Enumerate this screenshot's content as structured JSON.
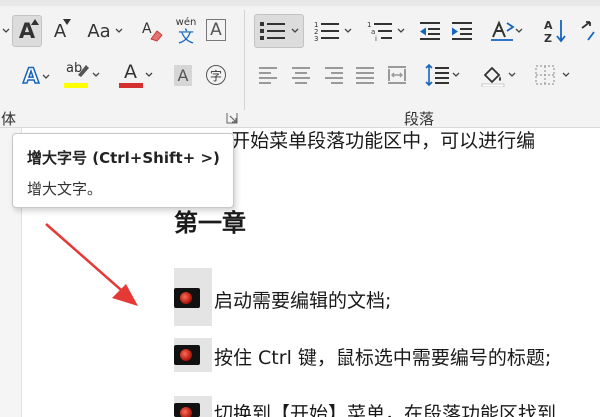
{
  "ribbon": {
    "font_size_dropdown_partial": "",
    "grow_font_label": "A",
    "shrink_font_label": "A",
    "change_case_label": "Aa",
    "phonetic_top": "wén",
    "phonetic_bottom": "文",
    "char_border_label": "A",
    "text_effects_label": "A",
    "highlight_label": "ab",
    "font_color_label": "A",
    "char_shading_label": "A",
    "enclose_char_label": "字",
    "font_group_label": "字体",
    "paragraph_group_label": "段落",
    "sort_label": "A↓Z",
    "highlight_color": "#ffff00",
    "font_color": "#d32f2f"
  },
  "tooltip": {
    "title": "增大字号 (Ctrl+Shift+ >)",
    "description": "增大文字。"
  },
  "document": {
    "partial_top_line": "d 开始菜单段落功能区中，可以进行编",
    "heading": "第一章",
    "lines": [
      "启动需要编辑的文档;",
      "按住 Ctrl 键，鼠标选中需要编号的标题;",
      "切换到【开始】菜单，在段落功能区找到"
    ]
  },
  "colors": {
    "arrow": "#e53935",
    "ribbon_bg": "#f3f3f3"
  }
}
